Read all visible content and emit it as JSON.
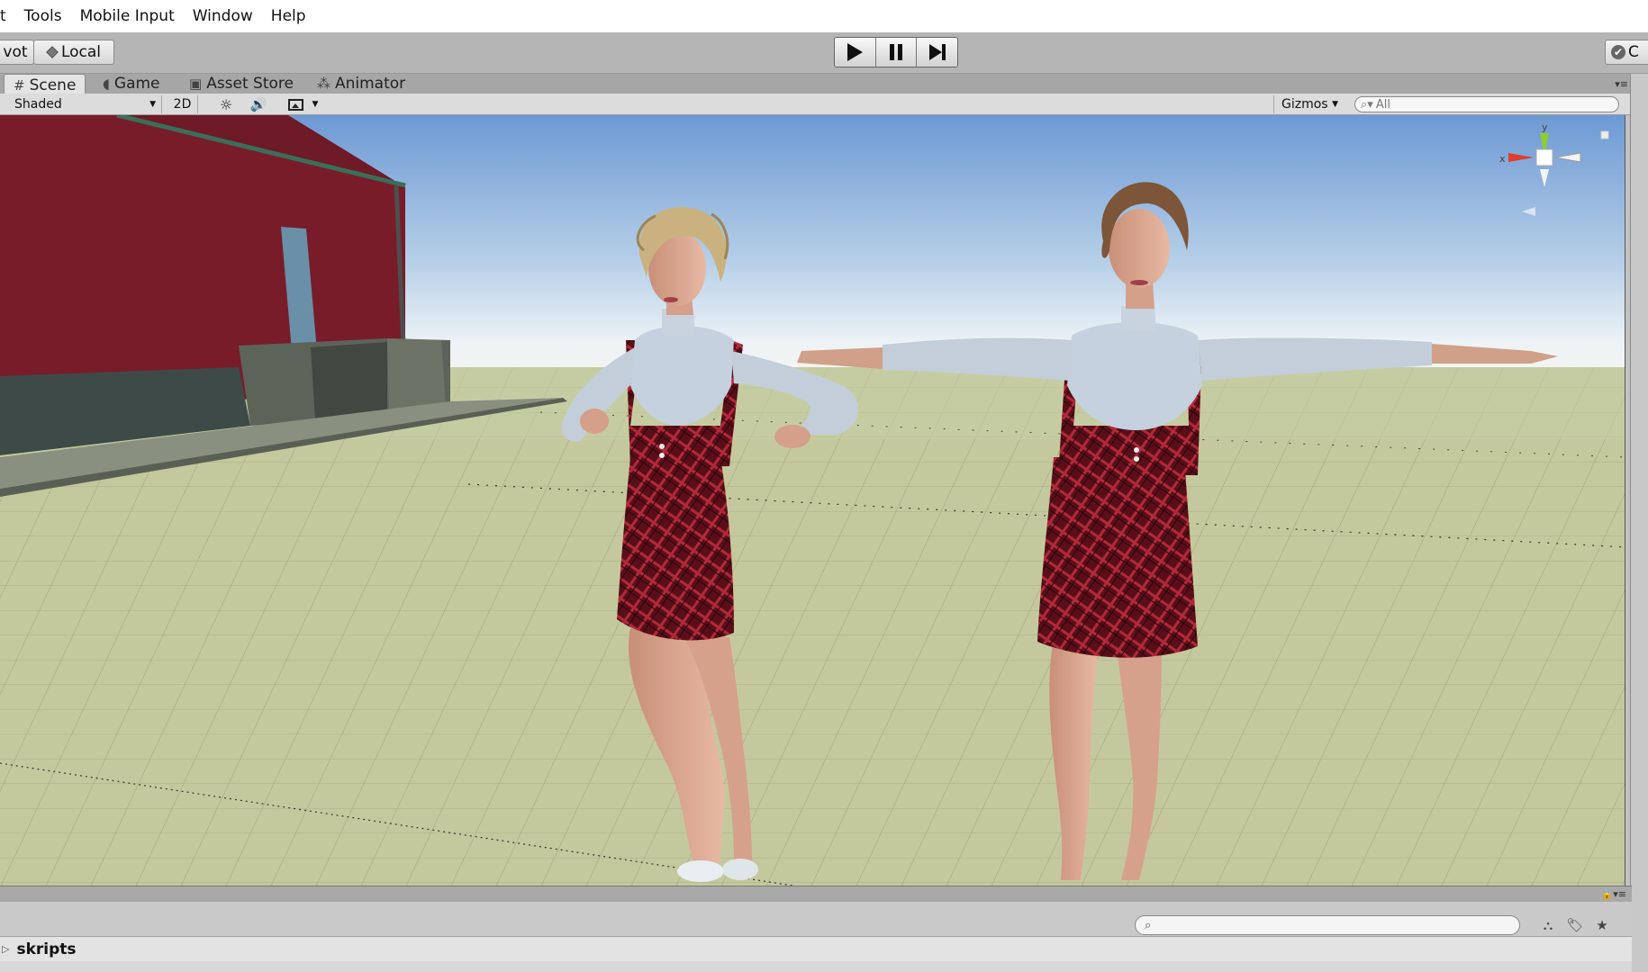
{
  "menubar": {
    "items": [
      "t",
      "Tools",
      "Mobile Input",
      "Window",
      "Help"
    ]
  },
  "toolbar": {
    "pivot_label": "vot",
    "local_label": "Local",
    "play_icon": "play-icon",
    "pause_icon": "pause-icon",
    "step_icon": "step-icon",
    "collab_label": "C"
  },
  "tabs": [
    {
      "label": "Scene",
      "icon": "grid-icon",
      "active": true
    },
    {
      "label": "Game",
      "icon": "pacman-icon",
      "active": false
    },
    {
      "label": "Asset Store",
      "icon": "shopping-bag-icon",
      "active": false
    },
    {
      "label": "Animator",
      "icon": "nodes-icon",
      "active": false
    }
  ],
  "scene_toolbar": {
    "shading_mode": "Shaded",
    "mode_2d": "2D",
    "gizmos": "Gizmos",
    "search_placeholder": "All"
  },
  "gizmo": {
    "y_label": "y",
    "x_label": "x",
    "colors": {
      "x": "#e23c2c",
      "y": "#8ccf2e",
      "z": "#ffffff"
    }
  },
  "project": {
    "folder": "skripts"
  },
  "colors": {
    "sky_top": "#6f9bd6",
    "sky_horizon": "#e6eef4",
    "ground": "#c3c99c",
    "barn": "#761d2a",
    "dress_plaid": "#6e1520",
    "sweater": "#c7d3df"
  }
}
